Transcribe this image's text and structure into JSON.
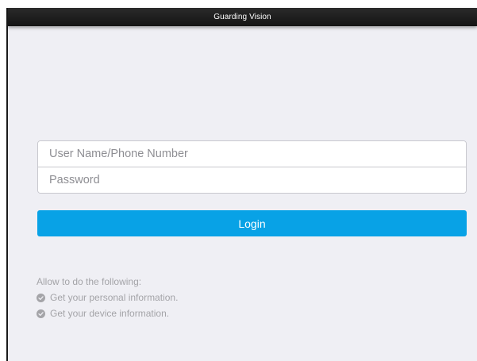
{
  "window": {
    "title": "Guarding Vision"
  },
  "login": {
    "username_placeholder": "User Name/Phone Number",
    "username_value": "",
    "password_placeholder": "Password",
    "password_value": "",
    "button_label": "Login",
    "button_color": "#08a2e6"
  },
  "permissions": {
    "heading": "Allow to do the following:",
    "items": [
      {
        "icon": "check-circle-icon",
        "label": "Get your personal information."
      },
      {
        "icon": "check-circle-icon",
        "label": "Get your device information."
      }
    ]
  }
}
